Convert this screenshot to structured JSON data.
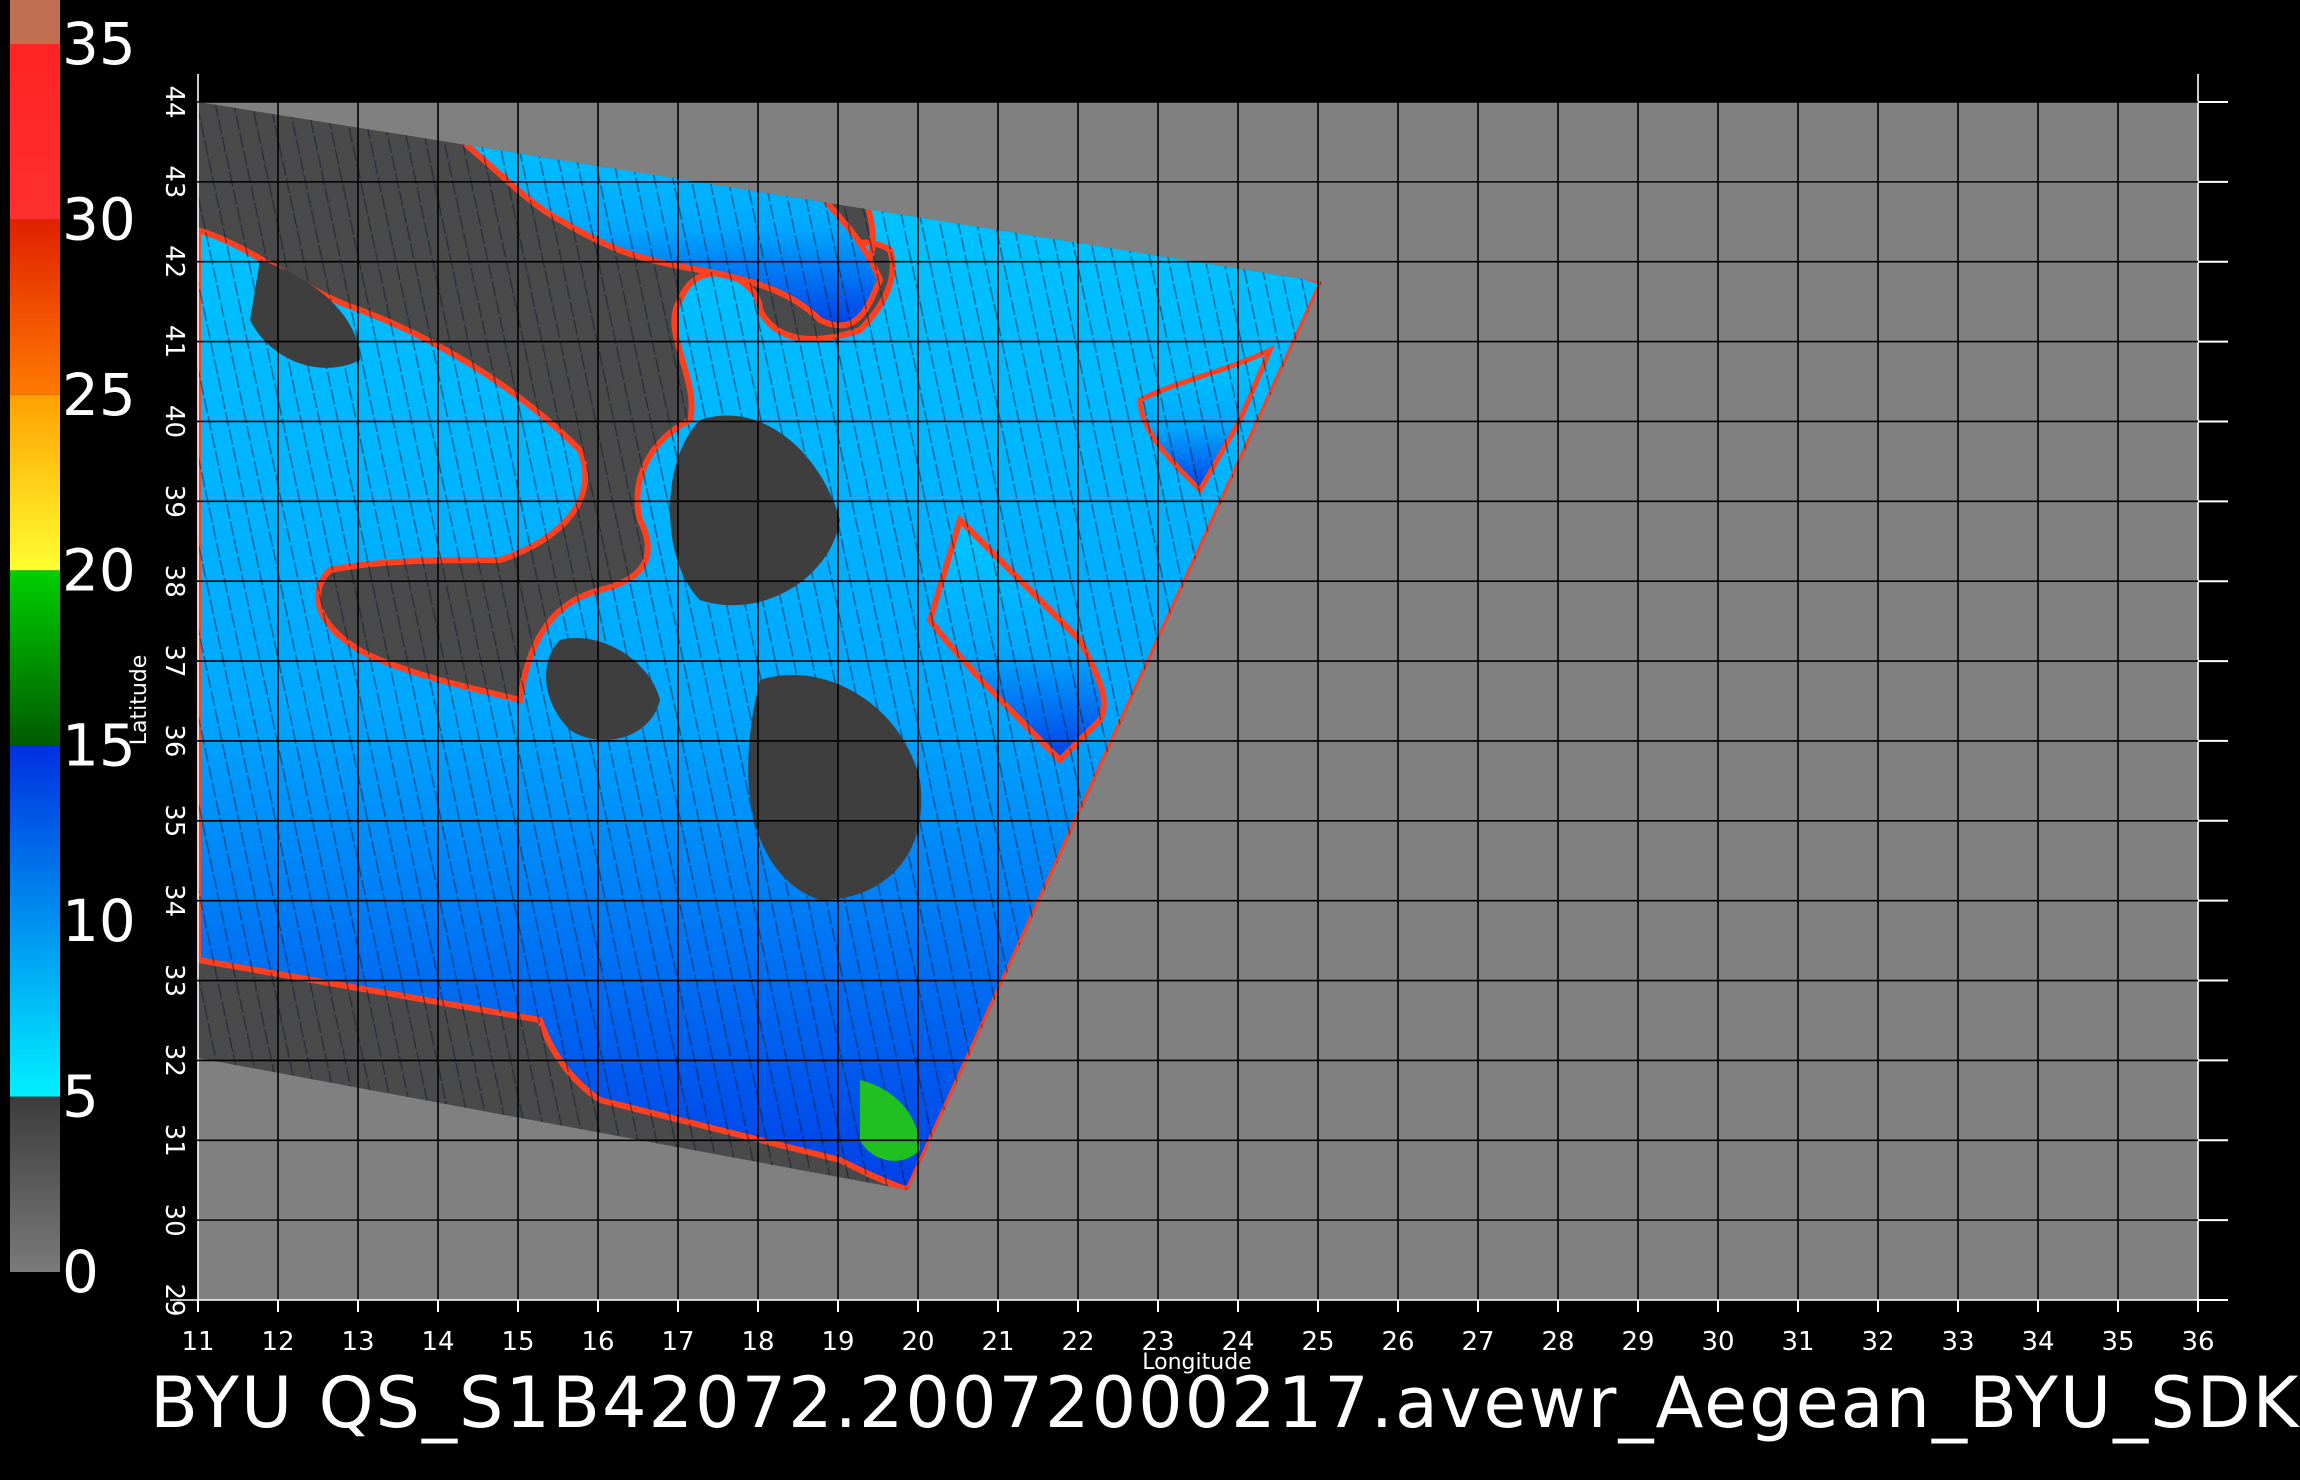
{
  "title": "BYU  QS_S1B42072.20072000217.avewr_Aegean_BYU_SDK",
  "map": {
    "type": "wind-speed-scatterometer-map",
    "x_axis": {
      "label": "Longitude",
      "min": 11,
      "max": 36,
      "ticks": [
        "11",
        "12",
        "13",
        "14",
        "15",
        "16",
        "17",
        "18",
        "19",
        "20",
        "21",
        "22",
        "23",
        "24",
        "25",
        "26",
        "27",
        "28",
        "29",
        "30",
        "31",
        "32",
        "33",
        "34",
        "35",
        "36"
      ]
    },
    "y_axis": {
      "label": "Latitude",
      "min": 29,
      "max": 44,
      "ticks": [
        "29",
        "30",
        "31",
        "32",
        "33",
        "34",
        "35",
        "36",
        "37",
        "38",
        "39",
        "40",
        "41",
        "42",
        "43",
        "44"
      ]
    },
    "grid": true,
    "colors": {
      "background": "#000000",
      "no_data": "#808080",
      "land": "#4a4a4a",
      "grid": "#000000"
    }
  },
  "colorbar": {
    "labels": [
      "0",
      "5",
      "10",
      "15",
      "20",
      "25",
      "30",
      "35"
    ],
    "segments": [
      {
        "from": 0,
        "to": 5,
        "color_top": "#3c3c3c",
        "color_bottom": "#7a7a7a"
      },
      {
        "from": 5,
        "to": 15,
        "color_top": "#0030e0",
        "color_bottom": "#00f0ff"
      },
      {
        "from": 15,
        "to": 20,
        "color_top": "#00d000",
        "color_bottom": "#005a00"
      },
      {
        "from": 20,
        "to": 25,
        "color_top": "#ffa000",
        "color_bottom": "#ffff30"
      },
      {
        "from": 25,
        "to": 30,
        "color_top": "#e02000",
        "color_bottom": "#ff7a00"
      },
      {
        "from": 30,
        "to": 35,
        "color_top": "#ff2020",
        "color_bottom": "#ff3030"
      },
      {
        "from": 35,
        "to": 36,
        "color_top": "#c07050",
        "color_bottom": "#c07050"
      }
    ]
  }
}
